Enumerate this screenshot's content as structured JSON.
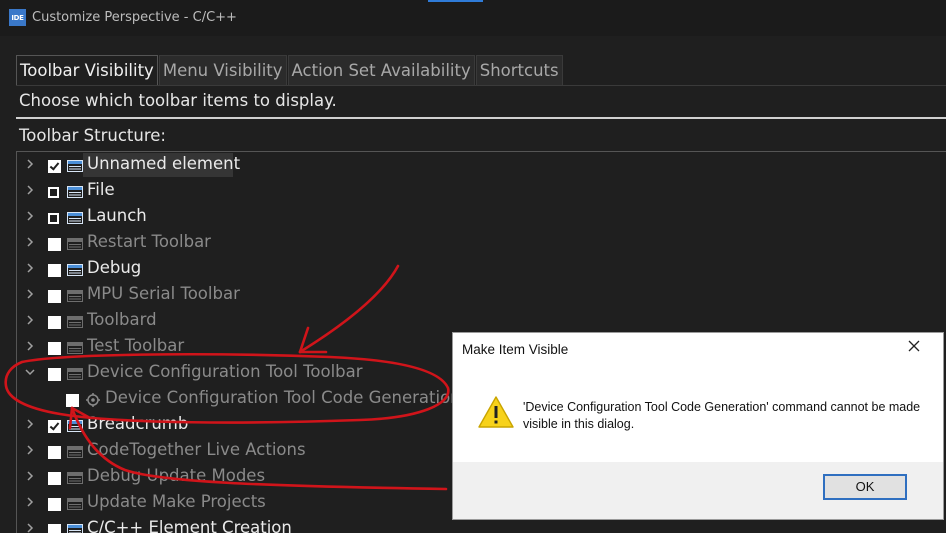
{
  "window": {
    "icon_text": "IDE",
    "title": "Customize Perspective - C/C++"
  },
  "tabs": [
    {
      "label": "Toolbar Visibility",
      "active": true
    },
    {
      "label": "Menu Visibility",
      "active": false
    },
    {
      "label": "Action Set Availability",
      "active": false
    },
    {
      "label": "Shortcuts",
      "active": false
    }
  ],
  "description": "Choose which toolbar items to display.",
  "structure_label": "Toolbar Structure:",
  "tree": [
    {
      "label": "Unnamed element",
      "state": "checked",
      "enabled": true,
      "expanded": false,
      "level": 0
    },
    {
      "label": "File",
      "state": "partial",
      "enabled": true,
      "expanded": false,
      "level": 0
    },
    {
      "label": "Launch",
      "state": "partial",
      "enabled": true,
      "expanded": false,
      "level": 0
    },
    {
      "label": "Restart Toolbar",
      "state": "unchecked",
      "enabled": false,
      "expanded": false,
      "level": 0
    },
    {
      "label": "Debug",
      "state": "unchecked",
      "enabled": true,
      "expanded": false,
      "level": 0
    },
    {
      "label": "MPU Serial Toolbar",
      "state": "unchecked",
      "enabled": false,
      "expanded": false,
      "level": 0
    },
    {
      "label": "Toolbard",
      "state": "unchecked",
      "enabled": false,
      "expanded": false,
      "level": 0
    },
    {
      "label": "Test Toolbar",
      "state": "unchecked",
      "enabled": false,
      "expanded": false,
      "level": 0
    },
    {
      "label": "Device Configuration Tool Toolbar",
      "state": "unchecked",
      "enabled": false,
      "expanded": true,
      "level": 0
    },
    {
      "label": "Device Configuration Tool Code Generation",
      "state": "unchecked",
      "enabled": false,
      "expanded": false,
      "level": 1
    },
    {
      "label": "Breadcrumb",
      "state": "checked",
      "enabled": true,
      "expanded": false,
      "level": 0
    },
    {
      "label": "CodeTogether Live Actions",
      "state": "unchecked",
      "enabled": false,
      "expanded": false,
      "level": 0
    },
    {
      "label": "Debug Update Modes",
      "state": "unchecked",
      "enabled": false,
      "expanded": false,
      "level": 0
    },
    {
      "label": "Update Make Projects",
      "state": "unchecked",
      "enabled": false,
      "expanded": false,
      "level": 0
    },
    {
      "label": "C/C++ Element Creation",
      "state": "unchecked",
      "enabled": true,
      "expanded": false,
      "level": 0
    }
  ],
  "dialog": {
    "title": "Make Item Visible",
    "message": "'Device Configuration Tool Code Generation' command cannot be made visible in this dialog.",
    "ok_label": "OK"
  },
  "colors": {
    "background": "#1f1f1f",
    "enabled_text": "#eaeaea",
    "disabled_text": "#8a8a8a",
    "annotation": "#d0141a",
    "accent": "#2f6fc0"
  }
}
